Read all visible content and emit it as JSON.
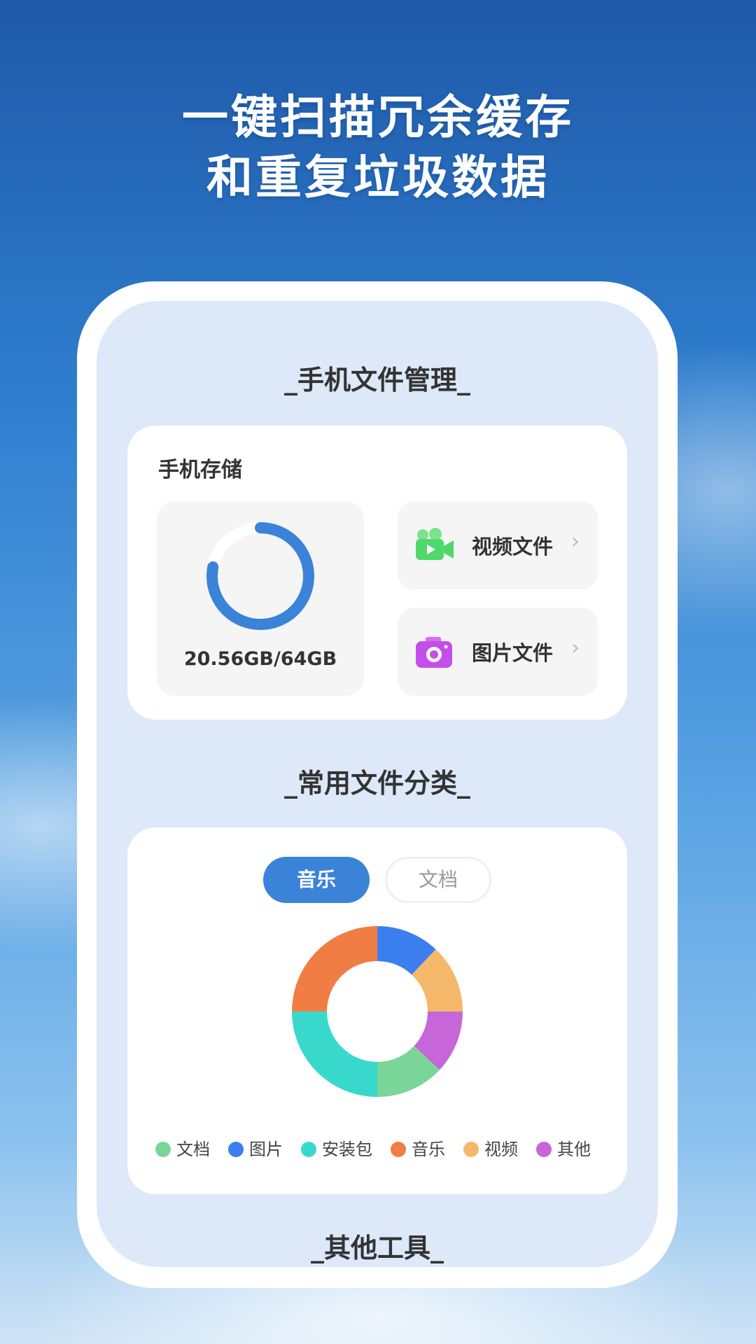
{
  "headline": {
    "line1": "一键扫描冗余缓存",
    "line2": "和重复垃圾数据"
  },
  "sections": {
    "file_management": "_手机文件管理_",
    "categories": "_常用文件分类_",
    "other_tools": "_其他工具_"
  },
  "storage": {
    "label": "手机存储",
    "used_gb": 20.56,
    "total_gb": 64,
    "usage_text": "20.56GB/64GB",
    "ring_color": "#3a83d9"
  },
  "file_buttons": [
    {
      "label": "视频文件",
      "icon": "video-camera-icon",
      "chevron": "›"
    },
    {
      "label": "图片文件",
      "icon": "photo-camera-icon",
      "chevron": "›"
    }
  ],
  "tabs": {
    "active": "音乐",
    "inactive": "文档"
  },
  "chart_data": {
    "type": "pie",
    "donut": true,
    "slices": [
      {
        "label": "图片",
        "value": 12,
        "color": "#3b7ef0"
      },
      {
        "label": "视频",
        "value": 13,
        "color": "#f5b86a"
      },
      {
        "label": "其他",
        "value": 12,
        "color": "#c766d8"
      },
      {
        "label": "文档",
        "value": 13,
        "color": "#79d698"
      },
      {
        "label": "安装包",
        "value": 25,
        "color": "#38d9cc"
      },
      {
        "label": "音乐",
        "value": 25,
        "color": "#f07d44"
      }
    ],
    "legend": [
      {
        "label": "文档",
        "color": "#79d698"
      },
      {
        "label": "图片",
        "color": "#3b7ef0"
      },
      {
        "label": "安装包",
        "color": "#38d9cc"
      },
      {
        "label": "音乐",
        "color": "#f07d44"
      },
      {
        "label": "视频",
        "color": "#f5b86a"
      },
      {
        "label": "其他",
        "color": "#c766d8"
      }
    ]
  }
}
